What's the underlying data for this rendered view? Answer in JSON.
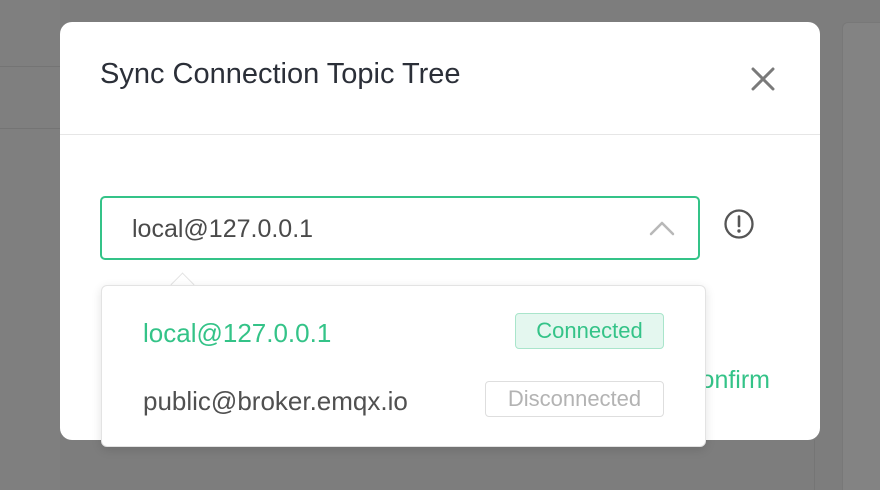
{
  "dialog": {
    "title": "Sync Connection Topic Tree",
    "confirm_label": "Confirm"
  },
  "select": {
    "value": "local@127.0.0.1"
  },
  "dropdown": {
    "options": [
      {
        "label": "local@127.0.0.1",
        "status": "Connected",
        "selected": true
      },
      {
        "label": "public@broker.emqx.io",
        "status": "Disconnected",
        "selected": false
      }
    ]
  },
  "icons": {
    "close": "close-icon",
    "chevron": "chevron-up-icon",
    "info": "info-icon"
  },
  "colors": {
    "accent": "#34c388",
    "overlay": "#7d7d7d"
  }
}
